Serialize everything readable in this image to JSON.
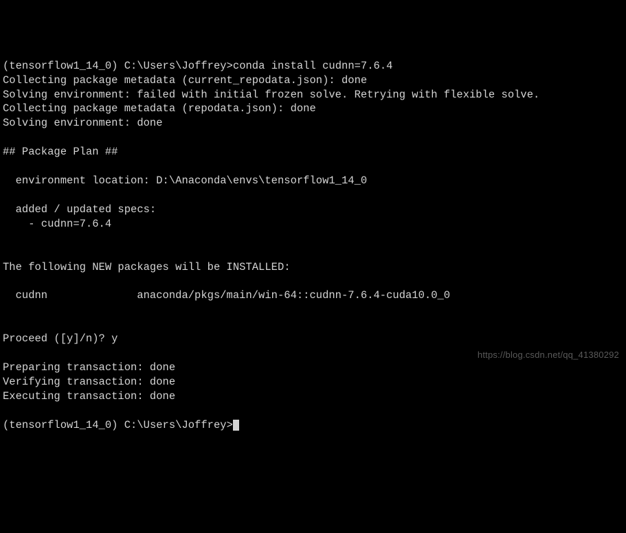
{
  "prompt1": {
    "env": "(tensorflow1_14_0)",
    "path": "C:\\Users\\Joffrey>",
    "command": "conda install cudnn=7.6.4"
  },
  "output": {
    "line1": "Collecting package metadata (current_repodata.json): done",
    "line2": "Solving environment: failed with initial frozen solve. Retrying with flexible solve.",
    "line3": "Collecting package metadata (repodata.json): done",
    "line4": "Solving environment: done",
    "plan_header": "## Package Plan ##",
    "env_location": "  environment location: D:\\Anaconda\\envs\\tensorflow1_14_0",
    "specs_header": "  added / updated specs:",
    "specs_item": "    - cudnn=7.6.4",
    "new_packages_header": "The following NEW packages will be INSTALLED:",
    "package_line": "  cudnn              anaconda/pkgs/main/win-64::cudnn-7.6.4-cuda10.0_0",
    "proceed_prompt": "Proceed ([y]/n)? ",
    "proceed_answer": "y",
    "preparing": "Preparing transaction: done",
    "verifying": "Verifying transaction: done",
    "executing": "Executing transaction: done"
  },
  "prompt2": {
    "env": "(tensorflow1_14_0)",
    "path": "C:\\Users\\Joffrey>"
  },
  "watermark": "https://blog.csdn.net/qq_41380292"
}
